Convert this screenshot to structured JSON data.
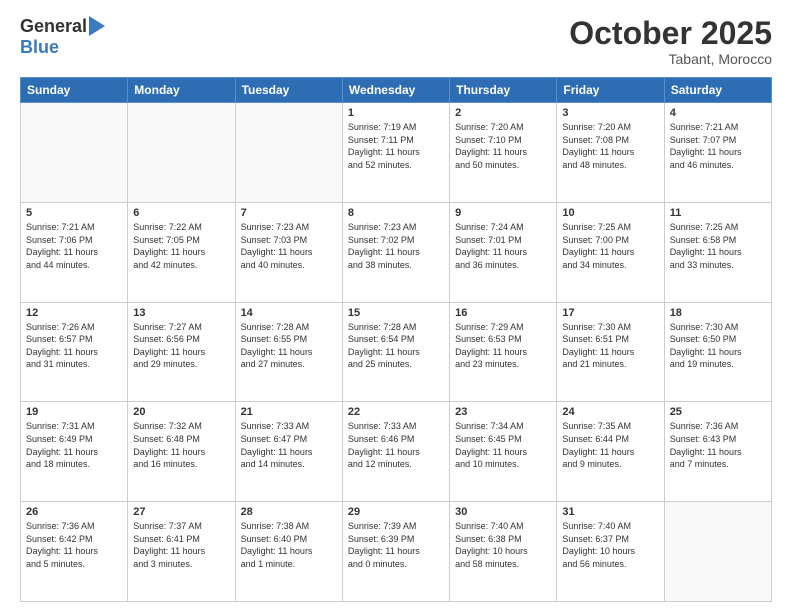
{
  "logo": {
    "general": "General",
    "blue": "Blue"
  },
  "title": "October 2025",
  "location": "Tabant, Morocco",
  "days_header": [
    "Sunday",
    "Monday",
    "Tuesday",
    "Wednesday",
    "Thursday",
    "Friday",
    "Saturday"
  ],
  "weeks": [
    [
      {
        "day": "",
        "info": ""
      },
      {
        "day": "",
        "info": ""
      },
      {
        "day": "",
        "info": ""
      },
      {
        "day": "1",
        "info": "Sunrise: 7:19 AM\nSunset: 7:11 PM\nDaylight: 11 hours\nand 52 minutes."
      },
      {
        "day": "2",
        "info": "Sunrise: 7:20 AM\nSunset: 7:10 PM\nDaylight: 11 hours\nand 50 minutes."
      },
      {
        "day": "3",
        "info": "Sunrise: 7:20 AM\nSunset: 7:08 PM\nDaylight: 11 hours\nand 48 minutes."
      },
      {
        "day": "4",
        "info": "Sunrise: 7:21 AM\nSunset: 7:07 PM\nDaylight: 11 hours\nand 46 minutes."
      }
    ],
    [
      {
        "day": "5",
        "info": "Sunrise: 7:21 AM\nSunset: 7:06 PM\nDaylight: 11 hours\nand 44 minutes."
      },
      {
        "day": "6",
        "info": "Sunrise: 7:22 AM\nSunset: 7:05 PM\nDaylight: 11 hours\nand 42 minutes."
      },
      {
        "day": "7",
        "info": "Sunrise: 7:23 AM\nSunset: 7:03 PM\nDaylight: 11 hours\nand 40 minutes."
      },
      {
        "day": "8",
        "info": "Sunrise: 7:23 AM\nSunset: 7:02 PM\nDaylight: 11 hours\nand 38 minutes."
      },
      {
        "day": "9",
        "info": "Sunrise: 7:24 AM\nSunset: 7:01 PM\nDaylight: 11 hours\nand 36 minutes."
      },
      {
        "day": "10",
        "info": "Sunrise: 7:25 AM\nSunset: 7:00 PM\nDaylight: 11 hours\nand 34 minutes."
      },
      {
        "day": "11",
        "info": "Sunrise: 7:25 AM\nSunset: 6:58 PM\nDaylight: 11 hours\nand 33 minutes."
      }
    ],
    [
      {
        "day": "12",
        "info": "Sunrise: 7:26 AM\nSunset: 6:57 PM\nDaylight: 11 hours\nand 31 minutes."
      },
      {
        "day": "13",
        "info": "Sunrise: 7:27 AM\nSunset: 6:56 PM\nDaylight: 11 hours\nand 29 minutes."
      },
      {
        "day": "14",
        "info": "Sunrise: 7:28 AM\nSunset: 6:55 PM\nDaylight: 11 hours\nand 27 minutes."
      },
      {
        "day": "15",
        "info": "Sunrise: 7:28 AM\nSunset: 6:54 PM\nDaylight: 11 hours\nand 25 minutes."
      },
      {
        "day": "16",
        "info": "Sunrise: 7:29 AM\nSunset: 6:53 PM\nDaylight: 11 hours\nand 23 minutes."
      },
      {
        "day": "17",
        "info": "Sunrise: 7:30 AM\nSunset: 6:51 PM\nDaylight: 11 hours\nand 21 minutes."
      },
      {
        "day": "18",
        "info": "Sunrise: 7:30 AM\nSunset: 6:50 PM\nDaylight: 11 hours\nand 19 minutes."
      }
    ],
    [
      {
        "day": "19",
        "info": "Sunrise: 7:31 AM\nSunset: 6:49 PM\nDaylight: 11 hours\nand 18 minutes."
      },
      {
        "day": "20",
        "info": "Sunrise: 7:32 AM\nSunset: 6:48 PM\nDaylight: 11 hours\nand 16 minutes."
      },
      {
        "day": "21",
        "info": "Sunrise: 7:33 AM\nSunset: 6:47 PM\nDaylight: 11 hours\nand 14 minutes."
      },
      {
        "day": "22",
        "info": "Sunrise: 7:33 AM\nSunset: 6:46 PM\nDaylight: 11 hours\nand 12 minutes."
      },
      {
        "day": "23",
        "info": "Sunrise: 7:34 AM\nSunset: 6:45 PM\nDaylight: 11 hours\nand 10 minutes."
      },
      {
        "day": "24",
        "info": "Sunrise: 7:35 AM\nSunset: 6:44 PM\nDaylight: 11 hours\nand 9 minutes."
      },
      {
        "day": "25",
        "info": "Sunrise: 7:36 AM\nSunset: 6:43 PM\nDaylight: 11 hours\nand 7 minutes."
      }
    ],
    [
      {
        "day": "26",
        "info": "Sunrise: 7:36 AM\nSunset: 6:42 PM\nDaylight: 11 hours\nand 5 minutes."
      },
      {
        "day": "27",
        "info": "Sunrise: 7:37 AM\nSunset: 6:41 PM\nDaylight: 11 hours\nand 3 minutes."
      },
      {
        "day": "28",
        "info": "Sunrise: 7:38 AM\nSunset: 6:40 PM\nDaylight: 11 hours\nand 1 minute."
      },
      {
        "day": "29",
        "info": "Sunrise: 7:39 AM\nSunset: 6:39 PM\nDaylight: 11 hours\nand 0 minutes."
      },
      {
        "day": "30",
        "info": "Sunrise: 7:40 AM\nSunset: 6:38 PM\nDaylight: 10 hours\nand 58 minutes."
      },
      {
        "day": "31",
        "info": "Sunrise: 7:40 AM\nSunset: 6:37 PM\nDaylight: 10 hours\nand 56 minutes."
      },
      {
        "day": "",
        "info": ""
      }
    ]
  ]
}
